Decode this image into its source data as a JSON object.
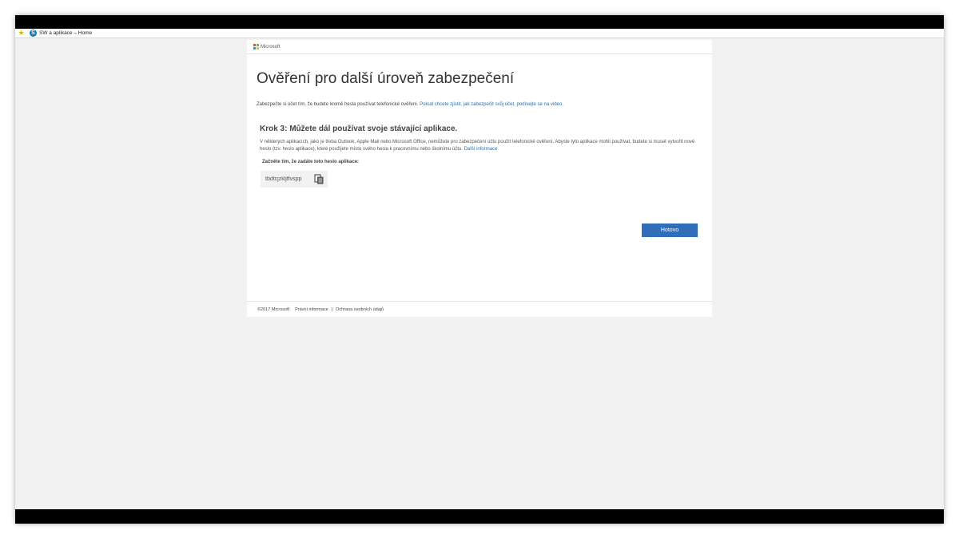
{
  "favorites_bar": {
    "favorite_label": "SW a aplikace – Home",
    "colors": {
      "star": "#e0b400",
      "sharepoint": "#0b7bbf"
    }
  },
  "header": {
    "brand": "Microsoft",
    "logo_colors": [
      "#f25022",
      "#7fba00",
      "#00a4ef",
      "#ffb900"
    ]
  },
  "main": {
    "title": "Ověření pro další úroveň zabezpečení",
    "intro_text": "Zabezpečte si účet tím, že budete kromě hesla používat telefonické ověření. ",
    "intro_link": "Pokud chcete zjistit, jak zabezpečit svůj účet, podívejte se na video.",
    "step_title": "Krok 3: Můžete dál používat svoje stávající aplikace.",
    "step_description": "V některých aplikacích, jako je třeba Outlook, Apple Mail nebo Microsoft Office, nemůžete pro zabezpečení účtu použít telefonické ověření. Abyste tyto aplikace mohli používat, budete si muset vytvořit nové heslo (tzv. heslo aplikace), které použijete místo svého hesla k pracovnímu nebo školnímu účtu. ",
    "step_link": "Další informace",
    "start_label": "Začněte tím, že zadáte toto heslo aplikace:",
    "app_password": "tbdtcjzkljffvspp",
    "done_button": "Hotovo",
    "accent": "#2f6fba",
    "link_color": "#1f6eb5"
  },
  "footer": {
    "copyright": "©2017 Microsoft",
    "legal": "Právní informace",
    "separator": "|",
    "privacy": "Ochrana osobních údajů"
  }
}
